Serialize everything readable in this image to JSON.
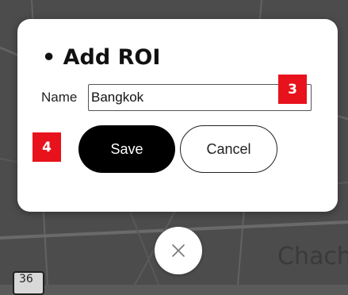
{
  "dialog": {
    "title": "• Add ROI",
    "name_label": "Name",
    "name_value": "Bangkok",
    "save_label": "Save",
    "cancel_label": "Cancel"
  },
  "badges": {
    "name_badge": "3",
    "save_badge": "4"
  },
  "close_button": {
    "icon": "close-icon"
  },
  "map": {
    "place_label": "Chach",
    "road_marker": "36"
  },
  "colors": {
    "badge": "#e8121c",
    "save_button": "#000000",
    "dialog_background": "#ffffff"
  }
}
